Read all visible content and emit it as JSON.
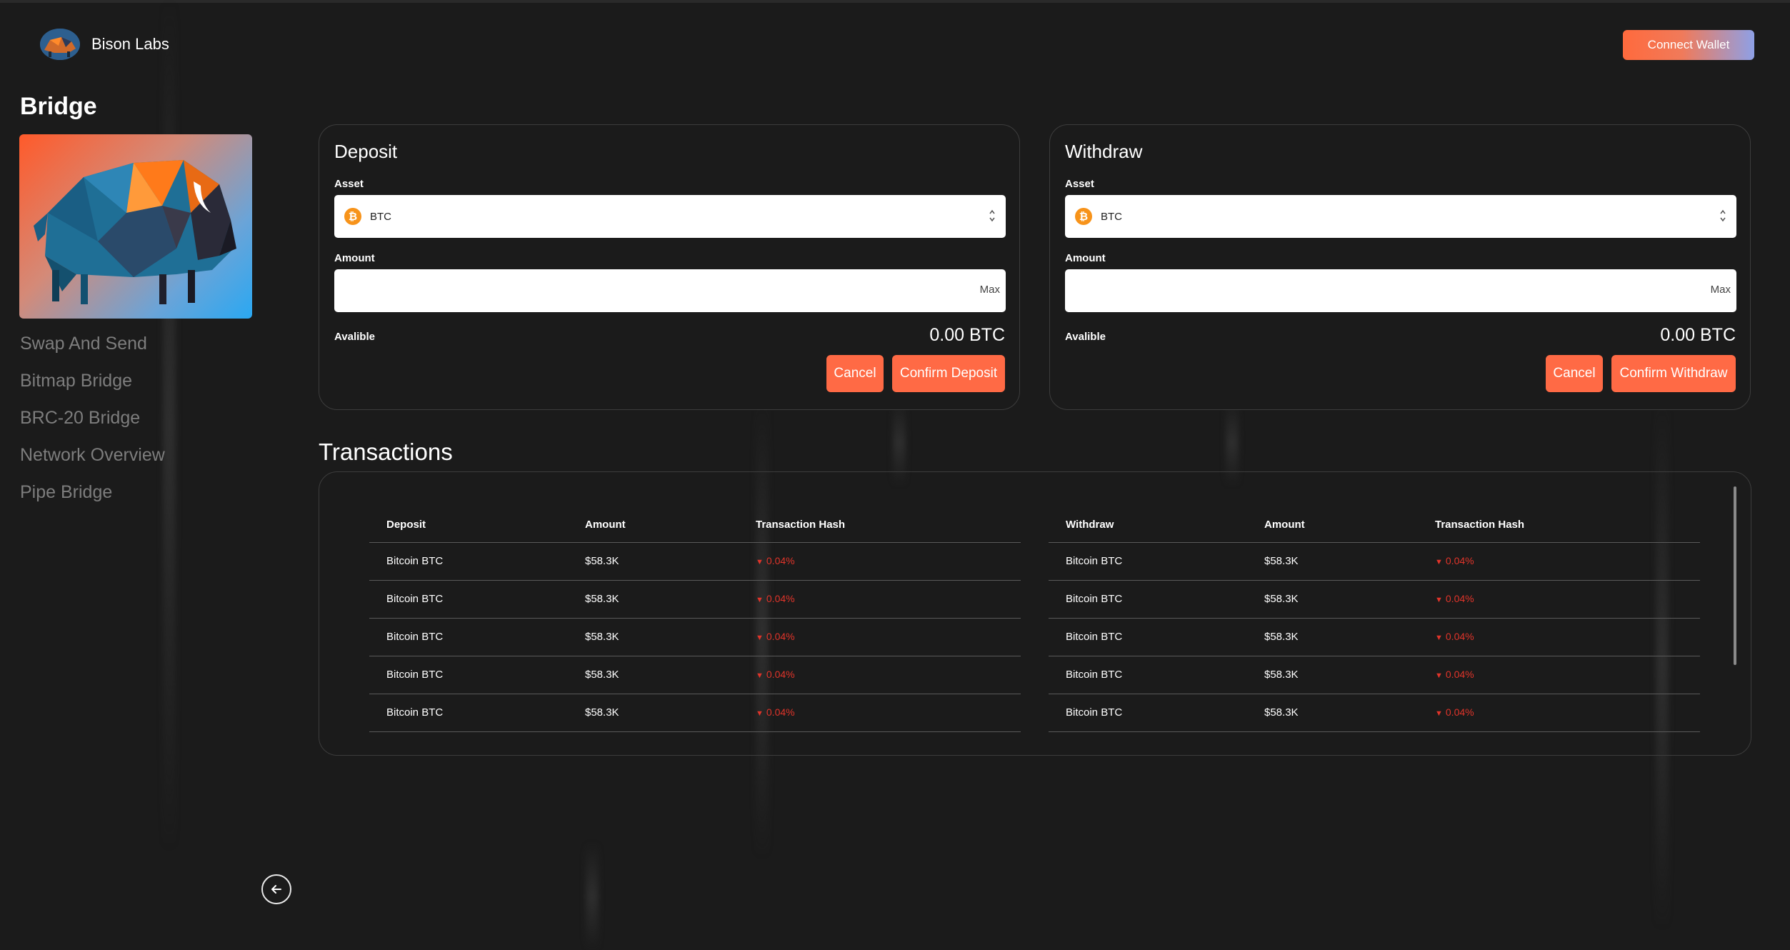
{
  "app": {
    "brand_name": "Bison Labs",
    "connect_wallet_label": "Connect Wallet"
  },
  "sidebar": {
    "title": "Bridge",
    "items": [
      {
        "label": "Swap And Send"
      },
      {
        "label": "Bitmap Bridge"
      },
      {
        "label": "BRC-20 Bridge"
      },
      {
        "label": "Network Overview"
      },
      {
        "label": "Pipe Bridge"
      }
    ]
  },
  "deposit": {
    "title": "Deposit",
    "asset_label": "Asset",
    "asset_value": "BTC",
    "amount_label": "Amount",
    "amount_value": "",
    "max_label": "Max",
    "available_label": "Avalible",
    "available_value": "0.00 BTC",
    "cancel_label": "Cancel",
    "confirm_label": "Confirm Deposit"
  },
  "withdraw": {
    "title": "Withdraw",
    "asset_label": "Asset",
    "asset_value": "BTC",
    "amount_label": "Amount",
    "amount_value": "",
    "max_label": "Max",
    "available_label": "Avalible",
    "available_value": "0.00 BTC",
    "cancel_label": "Cancel",
    "confirm_label": "Confirm Withdraw"
  },
  "transactions": {
    "title": "Transactions",
    "deposit_table": {
      "headers": [
        "Deposit",
        "Amount",
        "Transaction Hash"
      ],
      "rows": [
        [
          "Bitcoin BTC",
          "$58.3K",
          "0.04%"
        ],
        [
          "Bitcoin BTC",
          "$58.3K",
          "0.04%"
        ],
        [
          "Bitcoin BTC",
          "$58.3K",
          "0.04%"
        ],
        [
          "Bitcoin BTC",
          "$58.3K",
          "0.04%"
        ],
        [
          "Bitcoin BTC",
          "$58.3K",
          "0.04%"
        ]
      ]
    },
    "withdraw_table": {
      "headers": [
        "Withdraw",
        "Amount",
        "Transaction Hash"
      ],
      "rows": [
        [
          "Bitcoin BTC",
          "$58.3K",
          "0.04%"
        ],
        [
          "Bitcoin BTC",
          "$58.3K",
          "0.04%"
        ],
        [
          "Bitcoin BTC",
          "$58.3K",
          "0.04%"
        ],
        [
          "Bitcoin BTC",
          "$58.3K",
          "0.04%"
        ],
        [
          "Bitcoin BTC",
          "$58.3K",
          "0.04%"
        ]
      ]
    }
  },
  "icons": {
    "btc_coin_symbol": "₿",
    "down_triangle": "▼"
  },
  "colors": {
    "accent": "#ff6a45",
    "negative": "#e0342a",
    "background": "#1b1b1b"
  }
}
